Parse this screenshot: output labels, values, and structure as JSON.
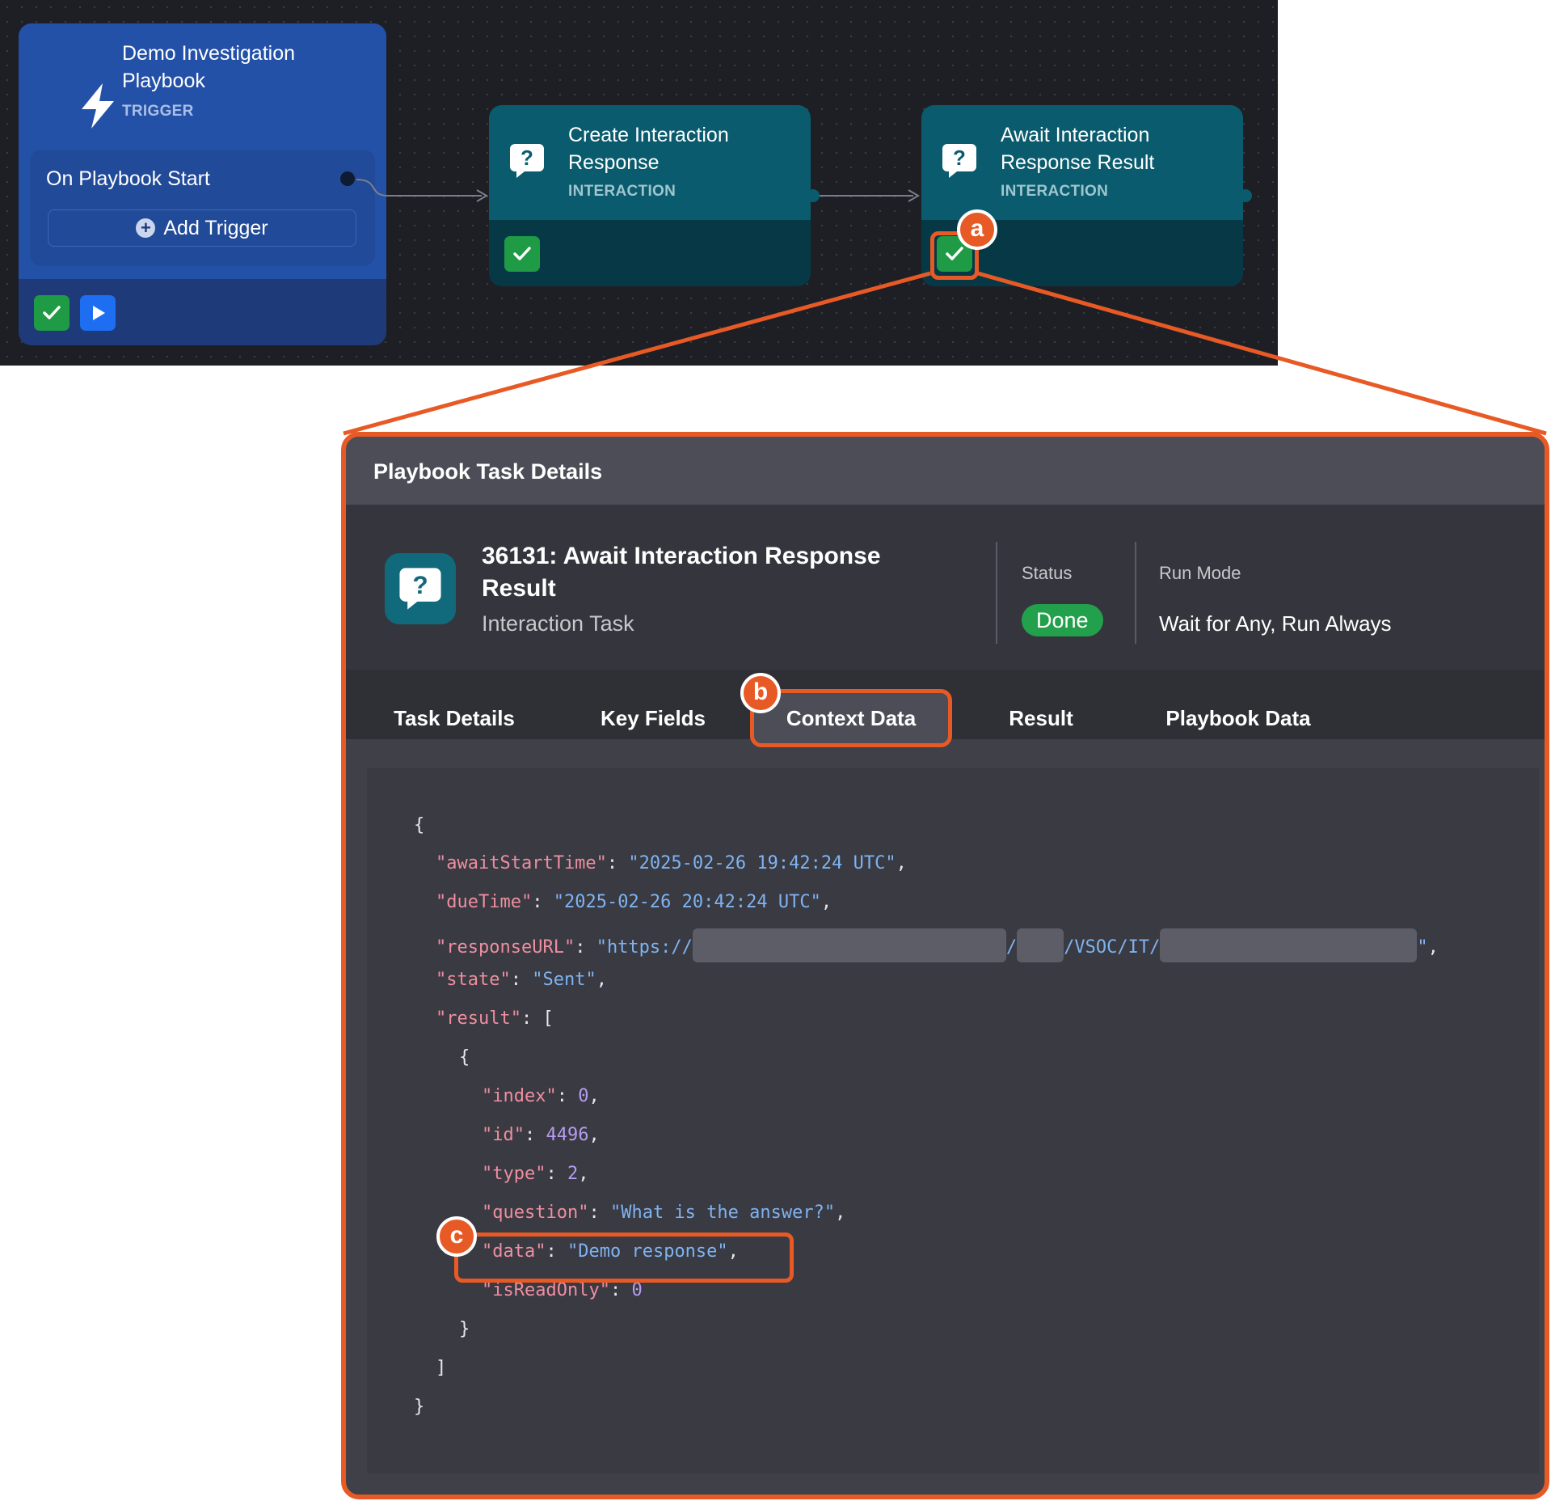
{
  "canvas": {
    "trigger_node": {
      "title": "Demo Investigation Playbook",
      "subtitle": "TRIGGER",
      "trigger_item": "On Playbook Start",
      "add_trigger_label": "Add Trigger"
    },
    "nodes": [
      {
        "title": "Create Interaction Response",
        "subtitle": "INTERACTION"
      },
      {
        "title": "Await Interaction Response Result",
        "subtitle": "INTERACTION"
      }
    ]
  },
  "callouts": {
    "a": "a",
    "b": "b",
    "c": "c"
  },
  "panel": {
    "title": "Playbook Task Details",
    "task_title": "36131: Await Interaction Response Result",
    "task_type": "Interaction Task",
    "status_label": "Status",
    "status_value": "Done",
    "run_mode_label": "Run Mode",
    "run_mode_value": "Wait for Any, Run Always",
    "tabs": [
      "Task Details",
      "Key Fields",
      "Context Data",
      "Result",
      "Playbook Data"
    ],
    "active_tab": "Context Data"
  },
  "context_json": {
    "awaitStartTime": "2025-02-26 19:42:24 UTC",
    "dueTime": "2025-02-26 20:42:24 UTC",
    "responseURL_prefix": "https://",
    "responseURL_mid": "/VSOC/IT/",
    "state": "Sent",
    "result": [
      {
        "index": "0",
        "id": "4496",
        "type": "2",
        "question": "What is the answer?",
        "data": "Demo response",
        "isReadOnly": "0"
      }
    ]
  },
  "colors": {
    "accent": "#e85a25",
    "success": "#23a04c",
    "teal": "#0a5b6d",
    "trigger_blue": "#2451a8"
  },
  "icons": [
    "bolt-icon",
    "question-bubble-icon",
    "check-icon",
    "play-icon",
    "plus-icon"
  ]
}
